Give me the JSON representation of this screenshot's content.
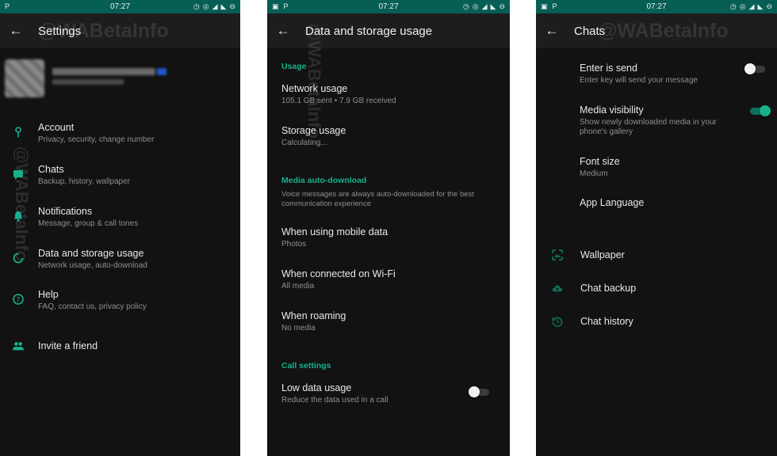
{
  "colors": {
    "accent": "#17b08d",
    "statusbar": "#075e54",
    "background": "#121212",
    "toolbar": "#1d1d1d"
  },
  "statusbar": {
    "time": "07:27",
    "left_icons": [
      "notification-icon",
      "parking-icon"
    ],
    "right_icons": [
      "alarm-icon",
      "hotspot-icon",
      "wifi-icon",
      "signal-icon",
      "battery-icon"
    ]
  },
  "watermark": "@WABetaInfo",
  "settings": {
    "title": "Settings",
    "items": [
      {
        "title": "Account",
        "subtitle": "Privacy, security, change number",
        "icon": "key-icon"
      },
      {
        "title": "Chats",
        "subtitle": "Backup, history, wallpaper",
        "icon": "chat-icon"
      },
      {
        "title": "Notifications",
        "subtitle": "Message, group & call tones",
        "icon": "bell-icon"
      },
      {
        "title": "Data and storage usage",
        "subtitle": "Network usage, auto-download",
        "icon": "data-usage-icon"
      },
      {
        "title": "Help",
        "subtitle": "FAQ, contact us, privacy policy",
        "icon": "help-icon"
      },
      {
        "title": "Invite a friend",
        "subtitle": "",
        "icon": "people-icon"
      }
    ]
  },
  "data_storage": {
    "title": "Data and storage usage",
    "usage_header": "Usage",
    "network_usage": {
      "title": "Network usage",
      "subtitle": "105.1 GB sent • 7.9 GB received"
    },
    "storage_usage": {
      "title": "Storage usage",
      "subtitle": "Calculating..."
    },
    "media_header": "Media auto-download",
    "media_note": "Voice messages are always auto-downloaded for the best communication experience",
    "mobile_data": {
      "title": "When using mobile data",
      "subtitle": "Photos"
    },
    "wifi": {
      "title": "When connected on Wi-Fi",
      "subtitle": "All media"
    },
    "roaming": {
      "title": "When roaming",
      "subtitle": "No media"
    },
    "call_header": "Call settings",
    "low_data": {
      "title": "Low data usage",
      "subtitle": "Reduce the data used in a call",
      "enabled": false
    }
  },
  "chats": {
    "title": "Chats",
    "enter_is_send": {
      "title": "Enter is send",
      "subtitle": "Enter key will send your message",
      "enabled": false
    },
    "media_visibility": {
      "title": "Media visibility",
      "subtitle": "Show newly downloaded media in your phone's gallery",
      "enabled": true
    },
    "font_size": {
      "title": "Font size",
      "subtitle": "Medium"
    },
    "app_language": {
      "title": "App Language"
    },
    "wallpaper": {
      "title": "Wallpaper",
      "icon": "wallpaper-icon"
    },
    "chat_backup": {
      "title": "Chat backup",
      "icon": "cloud-backup-icon"
    },
    "chat_history": {
      "title": "Chat history",
      "icon": "history-icon"
    }
  }
}
